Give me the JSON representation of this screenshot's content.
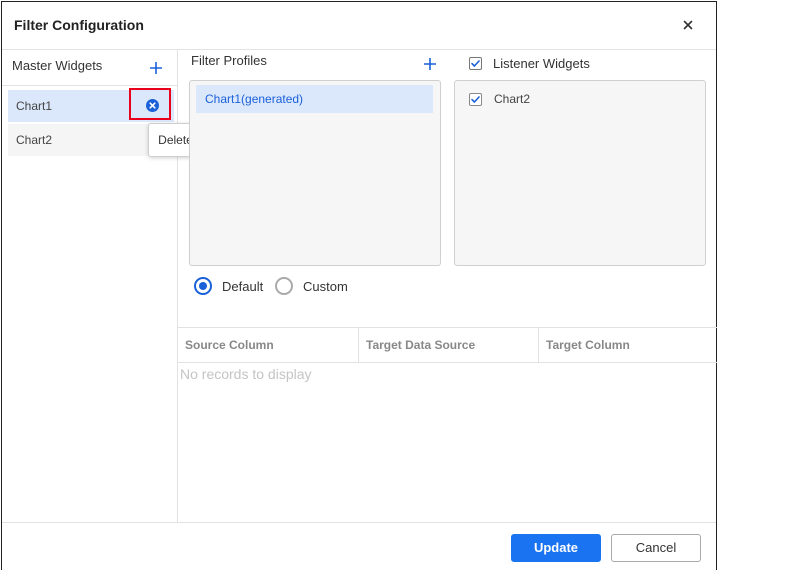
{
  "dialog": {
    "title": "Filter Configuration",
    "close_icon": "close-icon"
  },
  "master": {
    "header": "Master Widgets",
    "add_icon": "plus-icon",
    "items": [
      {
        "label": "Chart1",
        "selected": true
      },
      {
        "label": "Chart2",
        "selected": false
      }
    ],
    "delete_icon": "circle-x-icon",
    "tooltip": "Delete"
  },
  "profiles": {
    "header": "Filter Profiles",
    "add_icon": "plus-icon",
    "items": [
      {
        "label": "Chart1(generated)"
      }
    ]
  },
  "listeners": {
    "header": "Listener Widgets",
    "select_all_checked": true,
    "items": [
      {
        "label": "Chart2",
        "checked": true
      }
    ]
  },
  "mode": {
    "options": [
      {
        "label": "Default",
        "selected": true
      },
      {
        "label": "Custom",
        "selected": false
      }
    ]
  },
  "grid": {
    "columns": [
      "Source Column",
      "Target Data Source",
      "Target Column"
    ],
    "empty_text": "No records to display"
  },
  "footer": {
    "update_label": "Update",
    "cancel_label": "Cancel"
  },
  "colors": {
    "accent": "#1a73f0",
    "selected_bg": "#dbe8fb",
    "highlight_border": "#e8001c"
  }
}
